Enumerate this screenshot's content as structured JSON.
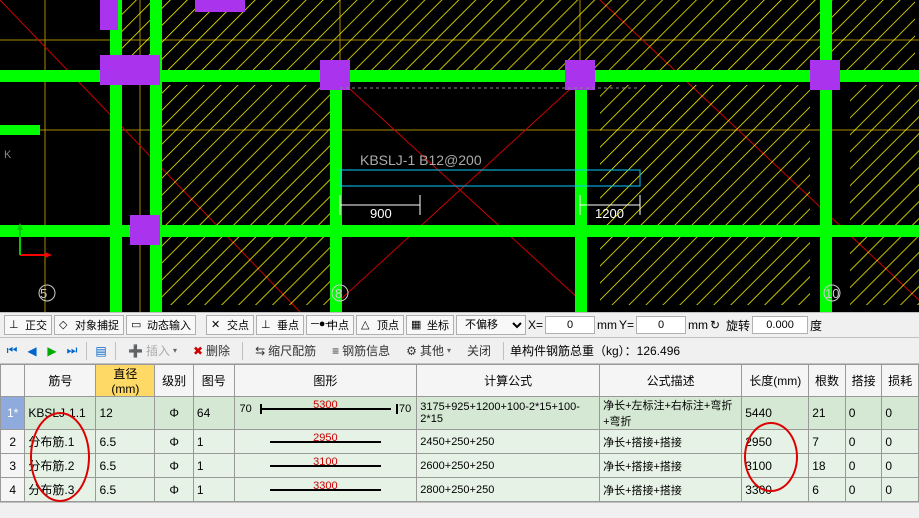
{
  "cad": {
    "label_main": "KBSLJ-1 B12@200",
    "dim_left": "900",
    "dim_right": "1200",
    "ruler": [
      "5",
      "8",
      "10"
    ]
  },
  "status": {
    "ortho": "正交",
    "osnap": "对象捕捉",
    "dyninput": "动态输入",
    "jiaodian": "交点",
    "chuizhi": "垂点",
    "zhongdian": "中点",
    "dingdian": "顶点",
    "zuobiao": "坐标",
    "offset_label": "不偏移",
    "x_label": "X=",
    "x_val": "0",
    "mm": "mm",
    "y_label": "Y=",
    "y_val": "0",
    "rotate": "旋转",
    "rot_val": "0.000",
    "deg": "度"
  },
  "toolbar": {
    "insert": "插入",
    "delete": "删除",
    "shrink": "缩尺配筋",
    "rebarinf": "钢筋信息",
    "other": "其他",
    "close": "关闭",
    "weight": "单构件钢筋总重（kg）：126.496"
  },
  "table": {
    "headers": {
      "jh": "筋号",
      "zj": "直径(mm)",
      "jb": "级别",
      "th": "图号",
      "tx": "图形",
      "gs": "计算公式",
      "ms": "公式描述",
      "cd": "长度(mm)",
      "gs2": "根数",
      "dj": "搭接",
      "sh": "损耗"
    },
    "rows": [
      {
        "n": "1*",
        "jh": "KBSLJ-1.1",
        "zj": "12",
        "jb": "Φ",
        "th": "64",
        "tx_lbl_l": "70",
        "tx_val": "5300",
        "tx_lbl_r": "70",
        "gs": "3175+925+1200+100-2*15+100-2*15",
        "ms": "净长+左标注+右标注+弯折+弯折",
        "cd": "5440",
        "gs2": "21",
        "dj": "0",
        "sh": "0",
        "sel": true
      },
      {
        "n": "2",
        "jh": "分布筋.1",
        "zj": "6.5",
        "jb": "Φ",
        "th": "1",
        "tx_val": "2950",
        "gs": "2450+250+250",
        "ms": "净长+搭接+搭接",
        "cd": "2950",
        "gs2": "7",
        "dj": "0",
        "sh": "0"
      },
      {
        "n": "3",
        "jh": "分布筋.2",
        "zj": "6.5",
        "jb": "Φ",
        "th": "1",
        "tx_val": "3100",
        "gs": "2600+250+250",
        "ms": "净长+搭接+搭接",
        "cd": "3100",
        "gs2": "18",
        "dj": "0",
        "sh": "0"
      },
      {
        "n": "4",
        "jh": "分布筋.3",
        "zj": "6.5",
        "jb": "Φ",
        "th": "1",
        "tx_val": "3300",
        "gs": "2800+250+250",
        "ms": "净长+搭接+搭接",
        "cd": "3300",
        "gs2": "6",
        "dj": "0",
        "sh": "0"
      }
    ]
  },
  "chart_data": {
    "type": "table",
    "title": "钢筋计算表",
    "columns": [
      "筋号",
      "直径(mm)",
      "级别",
      "图号",
      "图形长度",
      "计算公式",
      "公式描述",
      "长度(mm)",
      "根数",
      "搭接",
      "损耗"
    ],
    "rows": [
      [
        "KBSLJ-1.1",
        12,
        "Φ",
        64,
        5300,
        "3175+925+1200+100-2*15+100-2*15",
        "净长+左标注+右标注+弯折+弯折",
        5440,
        21,
        0,
        0
      ],
      [
        "分布筋.1",
        6.5,
        "Φ",
        1,
        2950,
        "2450+250+250",
        "净长+搭接+搭接",
        2950,
        7,
        0,
        0
      ],
      [
        "分布筋.2",
        6.5,
        "Φ",
        1,
        3100,
        "2600+250+250",
        "净长+搭接+搭接",
        3100,
        18,
        0,
        0
      ],
      [
        "分布筋.3",
        6.5,
        "Φ",
        1,
        3300,
        "2800+250+250",
        "净长+搭接+搭接",
        3300,
        6,
        0,
        0
      ]
    ]
  }
}
